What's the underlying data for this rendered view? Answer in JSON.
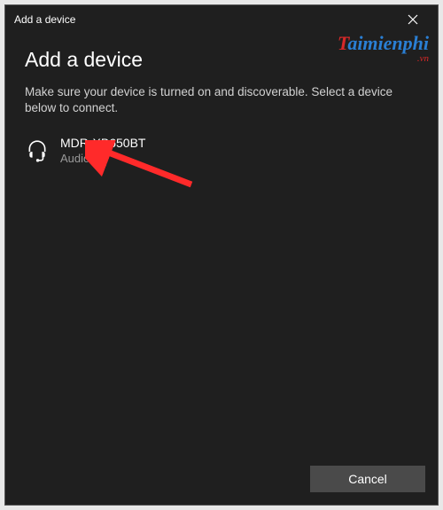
{
  "titlebar": {
    "title": "Add a device"
  },
  "content": {
    "heading": "Add a device",
    "instruction": "Make sure your device is turned on and discoverable. Select a device below to connect."
  },
  "devices": [
    {
      "name": "MDR-XB650BT",
      "type": "Audio",
      "icon": "headset-icon"
    }
  ],
  "footer": {
    "cancel_label": "Cancel"
  },
  "watermark": {
    "text_cap": "T",
    "text_rest": "aimienphi",
    "suffix": ".vn"
  },
  "annotation": {
    "arrow_color": "#ff2a2a"
  }
}
